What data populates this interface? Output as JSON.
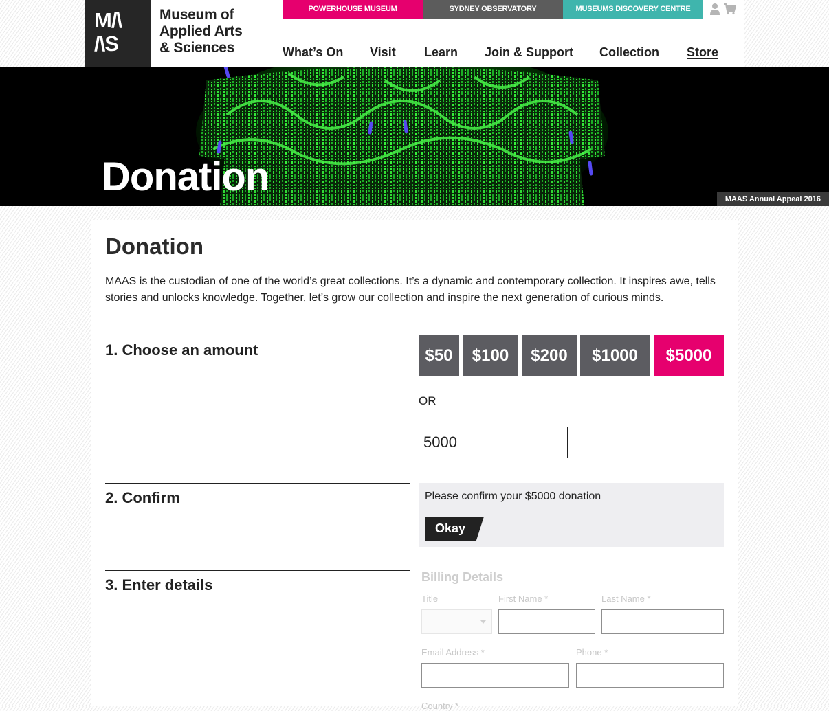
{
  "header": {
    "logo_text": [
      "M/\\",
      "/\\S"
    ],
    "org_name_lines": [
      "Museum of",
      "Applied Arts",
      "& Sciences"
    ],
    "venue_tabs": [
      "POWERHOUSE MUSEUM",
      "SYDNEY OBSERVATORY",
      "MUSEUMS DISCOVERY CENTRE"
    ],
    "venue_colors": [
      "#e6006e",
      "#5c5c5c",
      "#3fb5ad"
    ],
    "utility_icons": [
      "user-icon",
      "cart-icon"
    ],
    "nav": [
      "What’s On",
      "Visit",
      "Learn",
      "Join & Support",
      "Collection",
      "Store"
    ],
    "active_nav": "Store"
  },
  "hero": {
    "title": "Donation",
    "caption": "MAAS Annual Appeal 2016"
  },
  "main": {
    "title": "Donation",
    "intro": "MAAS is the custodian of one of the world’s great collections. It’s a dynamic and contemporary collection. It inspires awe, tells stories and unlocks knowledge. Together, let’s grow our collection and inspire the next generation of curious minds.",
    "step1": {
      "label": "1. Choose an amount",
      "amounts": [
        "$50",
        "$100",
        "$200",
        "$1000",
        "$5000"
      ],
      "selected": "$5000",
      "or_label": "OR",
      "custom_value": "5000"
    },
    "step2": {
      "label": "2. Confirm",
      "confirm_text": "Please confirm your $5000 donation",
      "okay_label": "Okay"
    },
    "step3": {
      "label": "3. Enter details",
      "billing_title": "Billing Details",
      "fields": {
        "title": "Title",
        "first_name": "First Name *",
        "last_name": "Last Name *",
        "email": "Email Address *",
        "phone": "Phone *",
        "country": "Country *"
      }
    }
  },
  "colors": {
    "accent_pink": "#e6006e",
    "button_grey": "#5c5c61",
    "confirm_bg": "#eeeef1",
    "chandelier_green": "#2ee63a"
  }
}
